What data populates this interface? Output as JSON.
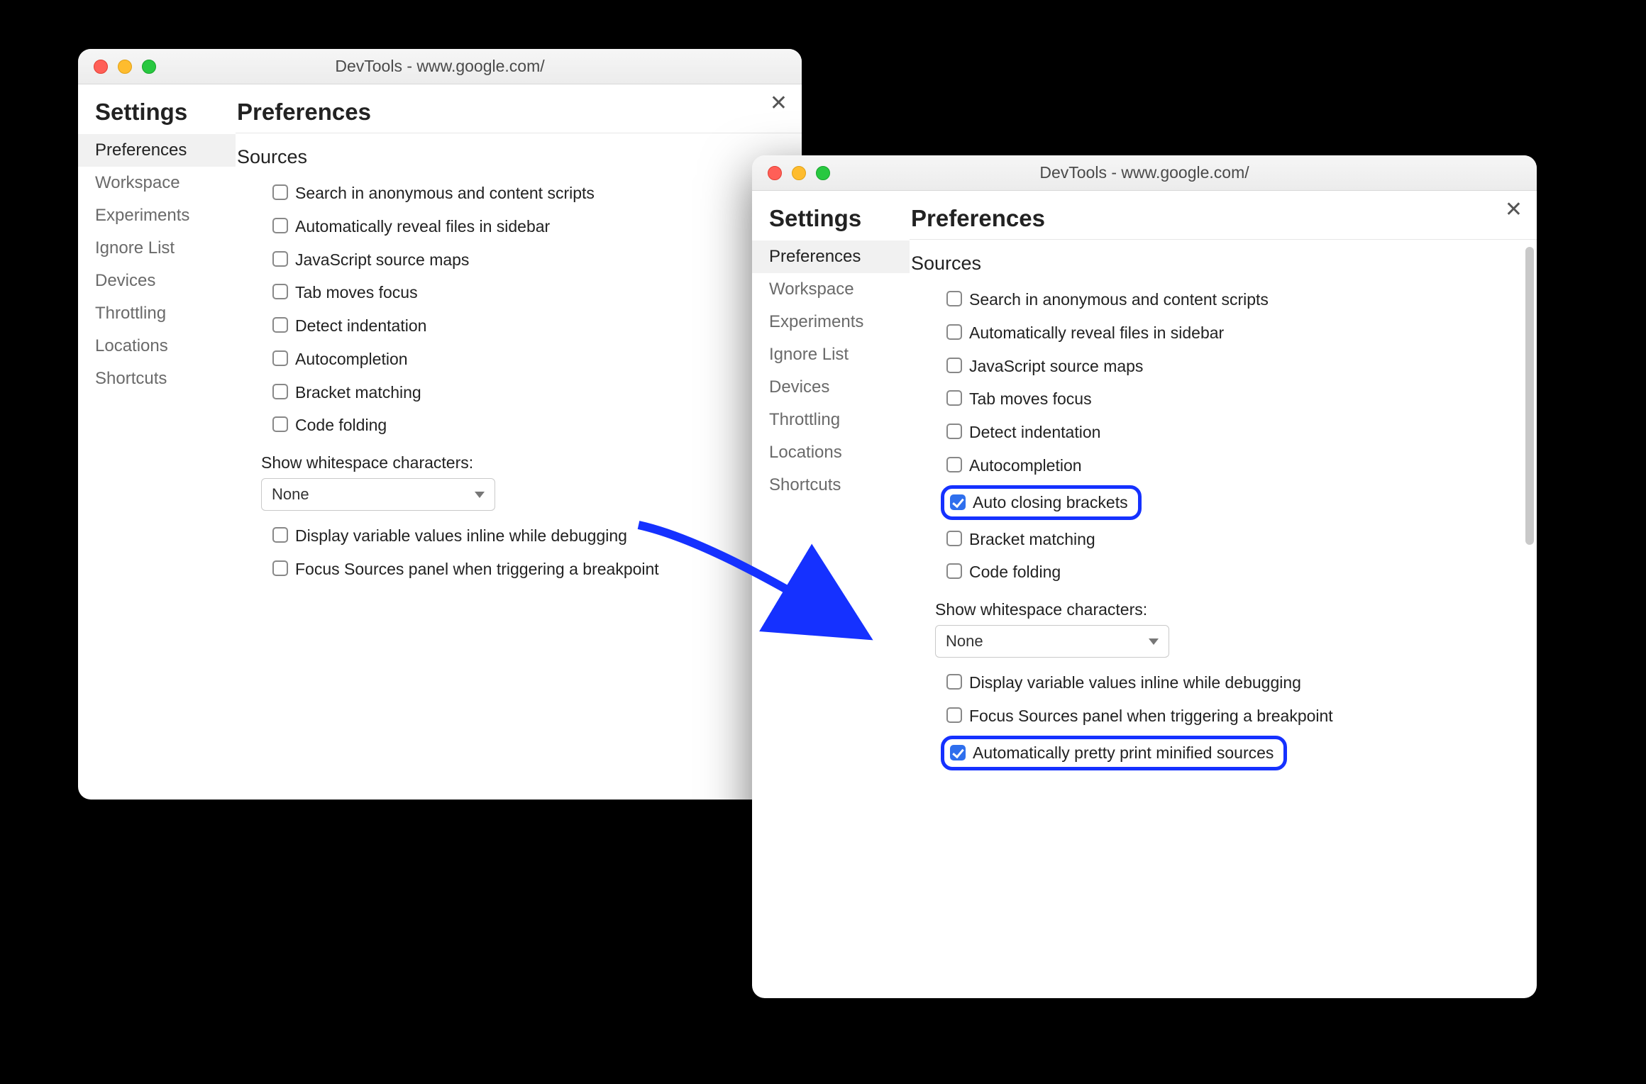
{
  "windows": {
    "left": {
      "title": "DevTools - www.google.com/",
      "settings_heading": "Settings",
      "preferences_heading": "Preferences",
      "sidebar": [
        {
          "label": "Preferences",
          "active": true
        },
        {
          "label": "Workspace",
          "active": false
        },
        {
          "label": "Experiments",
          "active": false
        },
        {
          "label": "Ignore List",
          "active": false
        },
        {
          "label": "Devices",
          "active": false
        },
        {
          "label": "Throttling",
          "active": false
        },
        {
          "label": "Locations",
          "active": false
        },
        {
          "label": "Shortcuts",
          "active": false
        }
      ],
      "section_heading": "Sources",
      "options": [
        {
          "label": "Search in anonymous and content scripts",
          "checked": false
        },
        {
          "label": "Automatically reveal files in sidebar",
          "checked": false
        },
        {
          "label": "JavaScript source maps",
          "checked": false
        },
        {
          "label": "Tab moves focus",
          "checked": false
        },
        {
          "label": "Detect indentation",
          "checked": false
        },
        {
          "label": "Autocompletion",
          "checked": false
        },
        {
          "label": "Bracket matching",
          "checked": false
        },
        {
          "label": "Code folding",
          "checked": false
        }
      ],
      "dropdown": {
        "label": "Show whitespace characters:",
        "value": "None"
      },
      "tail_options": [
        {
          "label": "Display variable values inline while debugging",
          "checked": false
        },
        {
          "label": "Focus Sources panel when triggering a breakpoint",
          "checked": false
        }
      ]
    },
    "right": {
      "title": "DevTools - www.google.com/",
      "settings_heading": "Settings",
      "preferences_heading": "Preferences",
      "sidebar": [
        {
          "label": "Preferences",
          "active": true
        },
        {
          "label": "Workspace",
          "active": false
        },
        {
          "label": "Experiments",
          "active": false
        },
        {
          "label": "Ignore List",
          "active": false
        },
        {
          "label": "Devices",
          "active": false
        },
        {
          "label": "Throttling",
          "active": false
        },
        {
          "label": "Locations",
          "active": false
        },
        {
          "label": "Shortcuts",
          "active": false
        }
      ],
      "section_heading": "Sources",
      "options_a": [
        {
          "label": "Search in anonymous and content scripts",
          "checked": false
        },
        {
          "label": "Automatically reveal files in sidebar",
          "checked": false
        },
        {
          "label": "JavaScript source maps",
          "checked": false
        },
        {
          "label": "Tab moves focus",
          "checked": false
        },
        {
          "label": "Detect indentation",
          "checked": false
        },
        {
          "label": "Autocompletion",
          "checked": false
        }
      ],
      "highlight1": {
        "label": "Auto closing brackets",
        "checked": true
      },
      "options_b": [
        {
          "label": "Bracket matching",
          "checked": false
        },
        {
          "label": "Code folding",
          "checked": false
        }
      ],
      "dropdown": {
        "label": "Show whitespace characters:",
        "value": "None"
      },
      "tail_options": [
        {
          "label": "Display variable values inline while debugging",
          "checked": false
        },
        {
          "label": "Focus Sources panel when triggering a breakpoint",
          "checked": false
        }
      ],
      "highlight2": {
        "label": "Automatically pretty print minified sources",
        "checked": true
      }
    }
  },
  "annotation": {
    "arrow_color": "#1531ff"
  }
}
